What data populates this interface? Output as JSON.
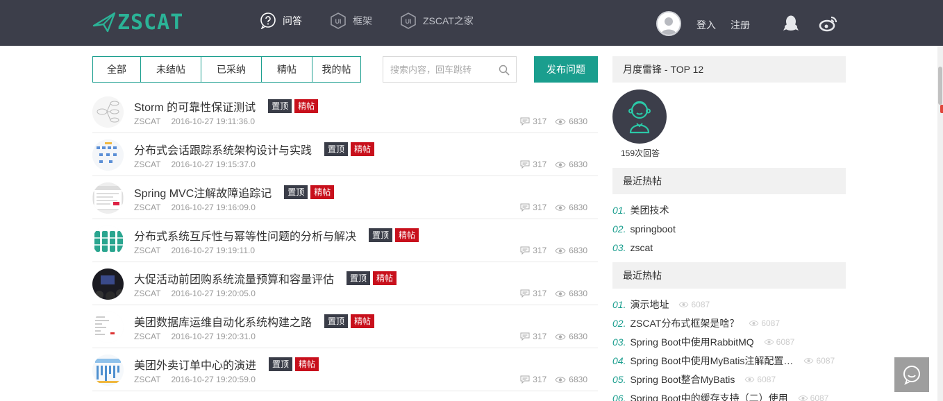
{
  "brand": {
    "logo_text": "ZSCAT",
    "accent": "#1a9e8e",
    "header_bg": "#3c3e4a"
  },
  "nav": [
    {
      "label": "问答",
      "icon": "question-icon",
      "active": true
    },
    {
      "label": "框架",
      "icon": "ui-badge-icon",
      "active": false
    },
    {
      "label": "ZSCAT之家",
      "icon": "ui-badge-icon",
      "active": false
    }
  ],
  "user": {
    "login": "登入",
    "register": "注册"
  },
  "filters": [
    {
      "label": "全部"
    },
    {
      "label": "未结帖"
    },
    {
      "label": "已采纳"
    },
    {
      "label": "精帖"
    },
    {
      "label": "我的帖"
    }
  ],
  "search": {
    "placeholder": "搜索内容，回车跳转"
  },
  "publish_label": "发布问题",
  "posts": [
    {
      "title": "Storm 的可靠性保证测试",
      "author": "ZSCAT",
      "time": "2016-10-27 19:11:36.0",
      "comments": "317",
      "views": "6830",
      "top": "置顶",
      "essence": "精帖"
    },
    {
      "title": "分布式会话跟踪系统架构设计与实践",
      "author": "ZSCAT",
      "time": "2016-10-27 19:15:37.0",
      "comments": "317",
      "views": "6830",
      "top": "置顶",
      "essence": "精帖"
    },
    {
      "title": "Spring MVC注解故障追踪记",
      "author": "ZSCAT",
      "time": "2016-10-27 19:16:09.0",
      "comments": "317",
      "views": "6830",
      "top": "置顶",
      "essence": "精帖"
    },
    {
      "title": "分布式系统互斥性与幂等性问题的分析与解决",
      "author": "ZSCAT",
      "time": "2016-10-27 19:19:11.0",
      "comments": "317",
      "views": "6830",
      "top": "置顶",
      "essence": "精帖"
    },
    {
      "title": "大促活动前团购系统流量预算和容量评估",
      "author": "ZSCAT",
      "time": "2016-10-27 19:20:05.0",
      "comments": "317",
      "views": "6830",
      "top": "置顶",
      "essence": "精帖"
    },
    {
      "title": "美团数据库运维自动化系统构建之路",
      "author": "ZSCAT",
      "time": "2016-10-27 19:20:31.0",
      "comments": "317",
      "views": "6830",
      "top": "置顶",
      "essence": "精帖"
    },
    {
      "title": "美团外卖订单中心的演进",
      "author": "ZSCAT",
      "time": "2016-10-27 19:20:59.0",
      "comments": "317",
      "views": "6830",
      "top": "置顶",
      "essence": "精帖"
    }
  ],
  "sidebar": {
    "top_title": "月度雷锋 - TOP 12",
    "top_user_answers": "159次回答",
    "hot1_title": "最近热帖",
    "hot1": [
      {
        "num": "01.",
        "label": "美团技术"
      },
      {
        "num": "02.",
        "label": "springboot"
      },
      {
        "num": "03.",
        "label": "zscat"
      }
    ],
    "hot2_title": "最近热帖",
    "hot2": [
      {
        "num": "01.",
        "label": "演示地址",
        "views": "6087"
      },
      {
        "num": "02.",
        "label": "ZSCAT分布式框架是啥？",
        "views": "6087"
      },
      {
        "num": "03.",
        "label": "Spring Boot中使用RabbitMQ",
        "views": "6087"
      },
      {
        "num": "04.",
        "label": "Spring Boot中使用MyBatis注解配置详解",
        "views": "6087"
      },
      {
        "num": "05.",
        "label": "Spring Boot整合MyBatis",
        "views": "6087"
      },
      {
        "num": "06.",
        "label": "Spring Boot中的缓存支持（二）使用",
        "views": "6087"
      }
    ]
  }
}
